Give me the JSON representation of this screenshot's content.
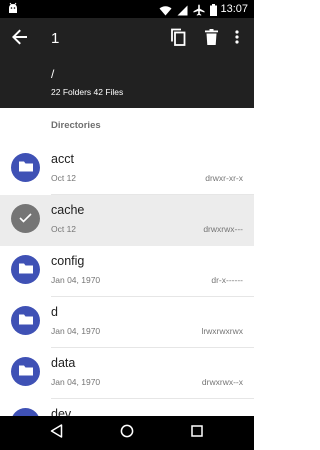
{
  "status_bar": {
    "time": "13:07",
    "icons": [
      "android-notification-icon",
      "wifi-icon",
      "signal-icon",
      "airplane-mode-icon",
      "battery-icon"
    ]
  },
  "app_bar": {
    "selection_count": "1",
    "path": "/",
    "summary": "22 Folders 42 Files",
    "background_color": "#212121"
  },
  "list": {
    "section_header": "Directories",
    "items": [
      {
        "name": "acct",
        "date": "Oct 12",
        "permissions": "drwxr-xr-x",
        "selected": false
      },
      {
        "name": "cache",
        "date": "Oct 12",
        "permissions": "drwxrwx---",
        "selected": true
      },
      {
        "name": "config",
        "date": "Jan 04, 1970",
        "permissions": "dr-x------",
        "selected": false
      },
      {
        "name": "d",
        "date": "Jan 04, 1970",
        "permissions": "lrwxrwxrwx",
        "selected": false
      },
      {
        "name": "data",
        "date": "Jan 04, 1970",
        "permissions": "drwxrwx--x",
        "selected": false
      },
      {
        "name": "dev",
        "date": "",
        "permissions": "",
        "selected": false
      }
    ]
  },
  "colors": {
    "folder_accent": "#3f51b5",
    "selected_circle": "#757575",
    "selected_row": "#ececec"
  },
  "nav_bar": {
    "buttons": [
      "back-triangle-icon",
      "home-circle-icon",
      "recents-square-icon"
    ]
  }
}
